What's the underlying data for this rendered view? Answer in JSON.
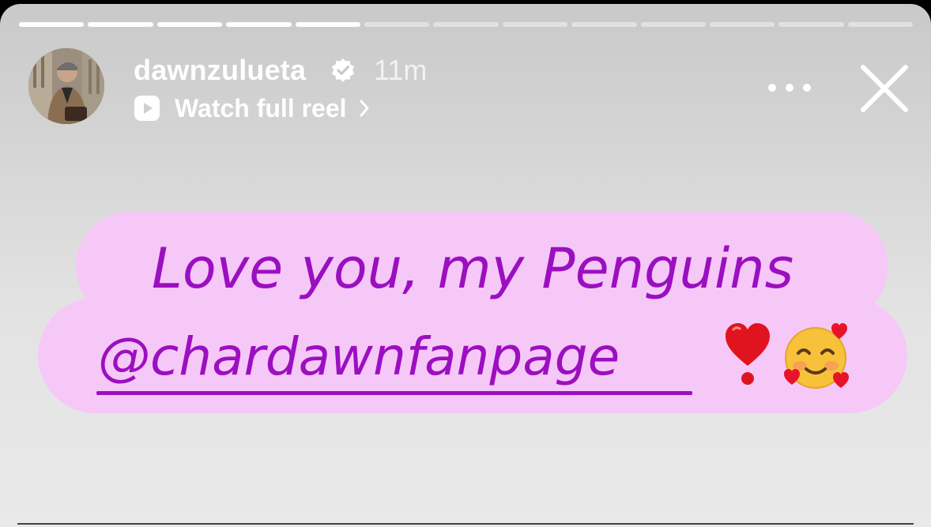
{
  "progress": {
    "total_segments": 13,
    "completed_segments": 5
  },
  "header": {
    "username": "dawnzulueta",
    "verified": true,
    "time_ago": "11m",
    "watch_reel_label": "Watch full reel"
  },
  "icons": {
    "verified": "verified-badge-icon",
    "reel": "reel-play-icon",
    "chevron": "chevron-right-icon",
    "more": "more-options-icon",
    "close": "close-icon",
    "heart": "exclamation-heart-emoji",
    "smiley": "smiling-face-with-hearts-emoji"
  },
  "sticker": {
    "line1": "Love you, my Penguins",
    "mention": "@chardawnfanpage",
    "background_color": "#f6c8f8",
    "text_color": "#9b0fc0"
  }
}
